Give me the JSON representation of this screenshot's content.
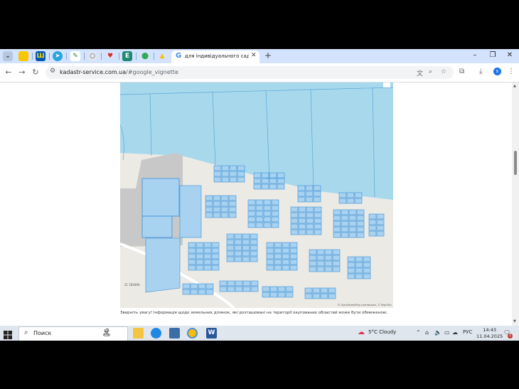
{
  "browser": {
    "tabs": [
      {
        "name": "tab-google",
        "label": "для індивідуального садівниц",
        "active": true
      }
    ],
    "close_tab_glyph": "✕",
    "new_tab_glyph": "+",
    "window_controls": {
      "minimize": "–",
      "maximize": "❐",
      "close": "✕"
    },
    "address": {
      "host": "kadastr-service.com.ua",
      "path": "/#google_vignette"
    },
    "nav": {
      "back": "←",
      "forward": "→",
      "reload": "↻"
    }
  },
  "page": {
    "notice": "Зверніть увагу! Інформація щодо земельних ділянок, які розташовані на території окупованих областей може бути обмеженою.",
    "map_attribution": "© OpenStreetMap contributors, © MapTiler",
    "map_scale_label": "21 181806"
  },
  "taskbar": {
    "search_placeholder": "Поиск",
    "weather": "5°C  Cloudy",
    "language": "РУС",
    "time": "14:43",
    "date": "11.04.2025",
    "notification_count": "1"
  },
  "colors": {
    "tabbar": "#d3e3fd",
    "map_blue": "#a8d8ec",
    "parcel_fill": "#a8d2f0",
    "parcel_border": "#3a8fd9",
    "taskbar": "#dfe6ed"
  }
}
